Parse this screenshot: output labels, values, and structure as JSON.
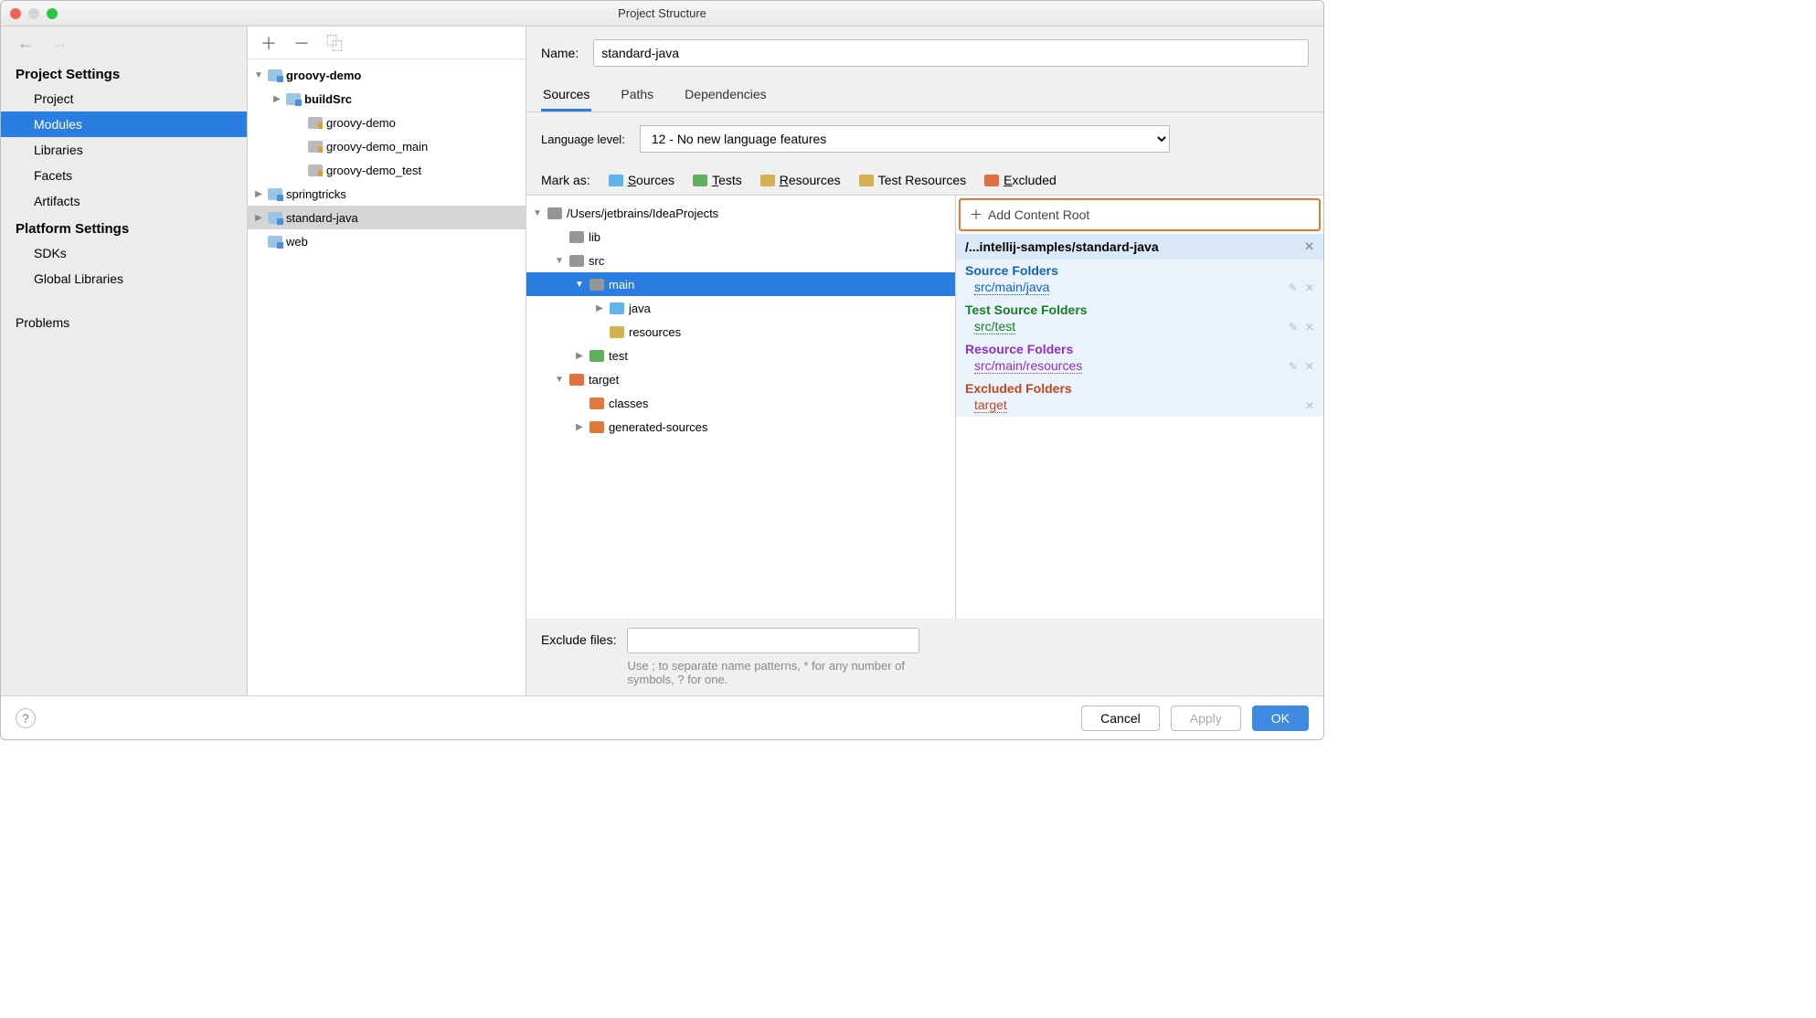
{
  "window": {
    "title": "Project Structure"
  },
  "sidebar": {
    "sections": [
      {
        "title": "Project Settings",
        "items": [
          "Project",
          "Modules",
          "Libraries",
          "Facets",
          "Artifacts"
        ],
        "selected": "Modules"
      },
      {
        "title": "Platform Settings",
        "items": [
          "SDKs",
          "Global Libraries"
        ]
      }
    ],
    "extra": "Problems"
  },
  "modules_tree": [
    {
      "label": "groovy-demo",
      "depth": 0,
      "expanded": true,
      "bold": true,
      "icon": "module",
      "arrow": "down"
    },
    {
      "label": "buildSrc",
      "depth": 1,
      "bold": true,
      "icon": "module",
      "arrow": "right"
    },
    {
      "label": "groovy-demo",
      "depth": 2,
      "icon": "dir-ind"
    },
    {
      "label": "groovy-demo_main",
      "depth": 2,
      "icon": "dir-ind"
    },
    {
      "label": "groovy-demo_test",
      "depth": 2,
      "icon": "dir-ind"
    },
    {
      "label": "springtricks",
      "depth": 0,
      "icon": "module",
      "arrow": "right"
    },
    {
      "label": "standard-java",
      "depth": 0,
      "icon": "module",
      "selected": true,
      "arrow": "right"
    },
    {
      "label": "web",
      "depth": 0,
      "icon": "module"
    }
  ],
  "detail": {
    "name_label": "Name:",
    "name_value": "standard-java",
    "tabs": [
      "Sources",
      "Paths",
      "Dependencies"
    ],
    "active_tab": "Sources",
    "lang_label": "Language level:",
    "lang_value": "12 - No new language features",
    "mark_label": "Mark as:",
    "marks": [
      {
        "label": "Sources",
        "u": "S",
        "color": "f-blue"
      },
      {
        "label": "Tests",
        "u": "T",
        "color": "f-green"
      },
      {
        "label": "Resources",
        "u": "R",
        "color": "f-yellow"
      },
      {
        "label": "Test Resources",
        "u": null,
        "color": "f-yellow"
      },
      {
        "label": "Excluded",
        "u": "E",
        "color": "f-orange"
      }
    ],
    "ftree": [
      {
        "label": "/Users/jetbrains/IdeaProjects",
        "depth": 0,
        "arrow": "down",
        "color": "f-gray"
      },
      {
        "label": "lib",
        "depth": 1,
        "arrow": "",
        "color": "f-gray"
      },
      {
        "label": "src",
        "depth": 1,
        "arrow": "down",
        "color": "f-gray"
      },
      {
        "label": "main",
        "depth": 2,
        "arrow": "down",
        "color": "f-gray",
        "selected": true
      },
      {
        "label": "java",
        "depth": 3,
        "arrow": "right",
        "color": "f-blue"
      },
      {
        "label": "resources",
        "depth": 3,
        "arrow": "",
        "color": "f-yellow"
      },
      {
        "label": "test",
        "depth": 2,
        "arrow": "right",
        "color": "f-green"
      },
      {
        "label": "target",
        "depth": 1,
        "arrow": "down",
        "color": "f-orange"
      },
      {
        "label": "classes",
        "depth": 2,
        "arrow": "",
        "color": "f-darkorange"
      },
      {
        "label": "generated-sources",
        "depth": 2,
        "arrow": "right",
        "color": "f-darkorange"
      }
    ],
    "add_root": "Add Content Root",
    "root_title": "/...intellij-samples/standard-java",
    "groups": [
      {
        "title": "Source Folders",
        "cls": "c-source",
        "items": [
          "src/main/java"
        ],
        "editable": true
      },
      {
        "title": "Test Source Folders",
        "cls": "c-test",
        "items": [
          "src/test"
        ],
        "editable": true
      },
      {
        "title": "Resource Folders",
        "cls": "c-resource",
        "items": [
          "src/main/resources"
        ],
        "editable": true
      },
      {
        "title": "Excluded Folders",
        "cls": "c-excluded",
        "items": [
          "target"
        ],
        "editable": false
      }
    ],
    "exclude_label": "Exclude files:",
    "exclude_hint": "Use ; to separate name patterns, * for any number of symbols, ? for one."
  },
  "footer": {
    "cancel": "Cancel",
    "apply": "Apply",
    "ok": "OK"
  }
}
